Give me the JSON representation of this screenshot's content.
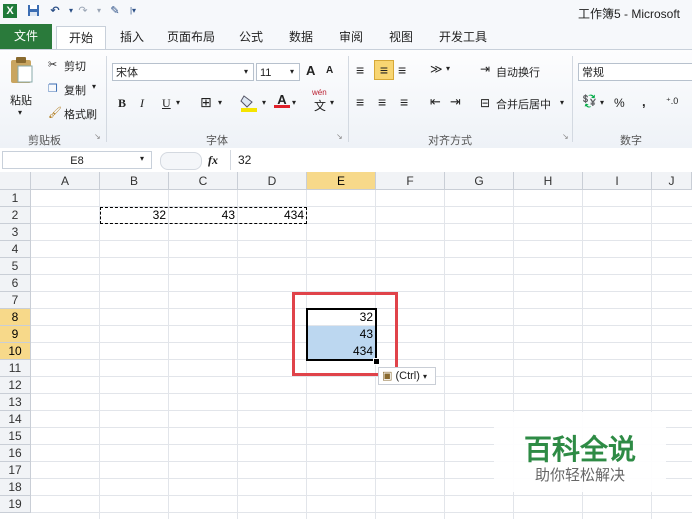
{
  "titlebar": {
    "title": "工作簿5 - Microsoft",
    "quick_access": [
      "excel-logo-icon",
      "save-icon",
      "undo-icon",
      "redo-icon",
      "customize-icon"
    ]
  },
  "tabs": [
    "文件",
    "开始",
    "插入",
    "页面布局",
    "公式",
    "数据",
    "审阅",
    "视图",
    "开发工具"
  ],
  "ribbon": {
    "clipboard": {
      "paste": "粘贴",
      "cut": "剪切",
      "copy": "复制",
      "format_painter": "格式刷",
      "label": "剪贴板"
    },
    "font": {
      "name": "宋体",
      "size": "11",
      "bold": "B",
      "italic": "I",
      "underline": "U",
      "label": "字体",
      "grow": "A",
      "shrink": "A",
      "wen": "wén"
    },
    "alignment": {
      "wrap": "自动换行",
      "merge": "合并后居中",
      "label": "对齐方式"
    },
    "number": {
      "format": "常规",
      "percent": "%",
      "comma": ",",
      "label": "数字"
    }
  },
  "formula_bar": {
    "name_box": "E8",
    "fx": "fx",
    "value": "32"
  },
  "columns": [
    "A",
    "B",
    "C",
    "D",
    "E",
    "F",
    "G",
    "H",
    "I",
    "J"
  ],
  "rows": [
    "1",
    "2",
    "3",
    "4",
    "5",
    "6",
    "7",
    "8",
    "9",
    "10",
    "11",
    "12",
    "13",
    "14",
    "15",
    "16",
    "17",
    "18",
    "19"
  ],
  "cells": {
    "B2": "32",
    "C2": "43",
    "D2": "434",
    "E8": "32",
    "E9": "43",
    "E10": "434"
  },
  "paste_options": {
    "label": "(Ctrl)"
  },
  "watermark": {
    "title": "百科全说",
    "subtitle": "助你轻松解决"
  },
  "colors": {
    "file_tab": "#2a7a3b",
    "selection": "#bcd7f0",
    "highlight_box": "#e0434a",
    "active_header": "#f7d98a"
  }
}
